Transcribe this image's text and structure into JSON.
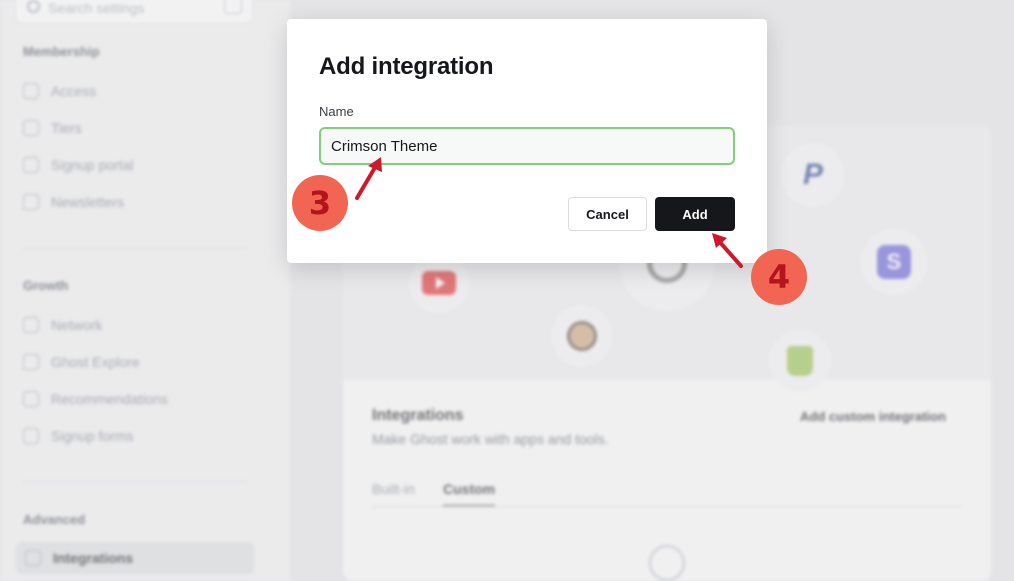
{
  "sidebar": {
    "search_placeholder": "Search settings",
    "sections": [
      {
        "title": "Membership",
        "items": [
          "Access",
          "Tiers",
          "Signup portal",
          "Newsletters"
        ]
      },
      {
        "title": "Growth",
        "items": [
          "Network",
          "Ghost Explore",
          "Recommendations",
          "Signup forms"
        ]
      },
      {
        "title": "Advanced",
        "items": [
          "Integrations"
        ]
      }
    ]
  },
  "main": {
    "integrations_title": "Integrations",
    "integrations_subtitle": "Make Ghost work with apps and tools.",
    "add_custom_label": "Add custom integration",
    "tabs": [
      "Built-in",
      "Custom"
    ],
    "stripe_letter": "S"
  },
  "modal": {
    "title": "Add integration",
    "name_label": "Name",
    "name_value": "Crimson Theme",
    "cancel_label": "Cancel",
    "add_label": "Add"
  },
  "annotations": {
    "steps": [
      "3",
      "4"
    ],
    "color": "#f26553"
  }
}
